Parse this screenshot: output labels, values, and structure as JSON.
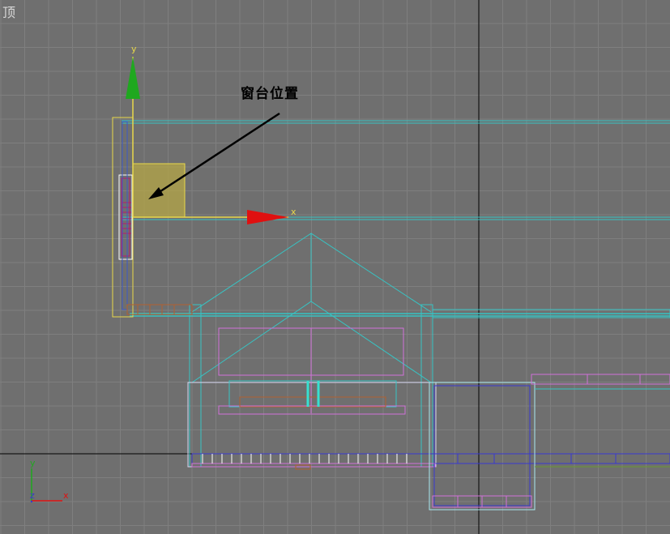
{
  "viewport": {
    "label": "顶"
  },
  "annotation": {
    "text": "窗台位置"
  },
  "gizmo": {
    "y_label": "y",
    "x_label": "x"
  },
  "view_axes": {
    "y_label": "y",
    "z_label": "z",
    "x_label": "x"
  },
  "colors": {
    "background": "#6f6f6f",
    "grid": "#808080",
    "axis_line": "#000000",
    "gizmo_y": "#1fa81f",
    "gizmo_x": "#e01010",
    "gizmo_plane": "#b4a646",
    "selection": "#e8d84a",
    "wire_cyan": "#37c4c4",
    "wire_magenta": "#d070d8",
    "wire_blue": "#3838d0",
    "wire_brown": "#b06030"
  }
}
